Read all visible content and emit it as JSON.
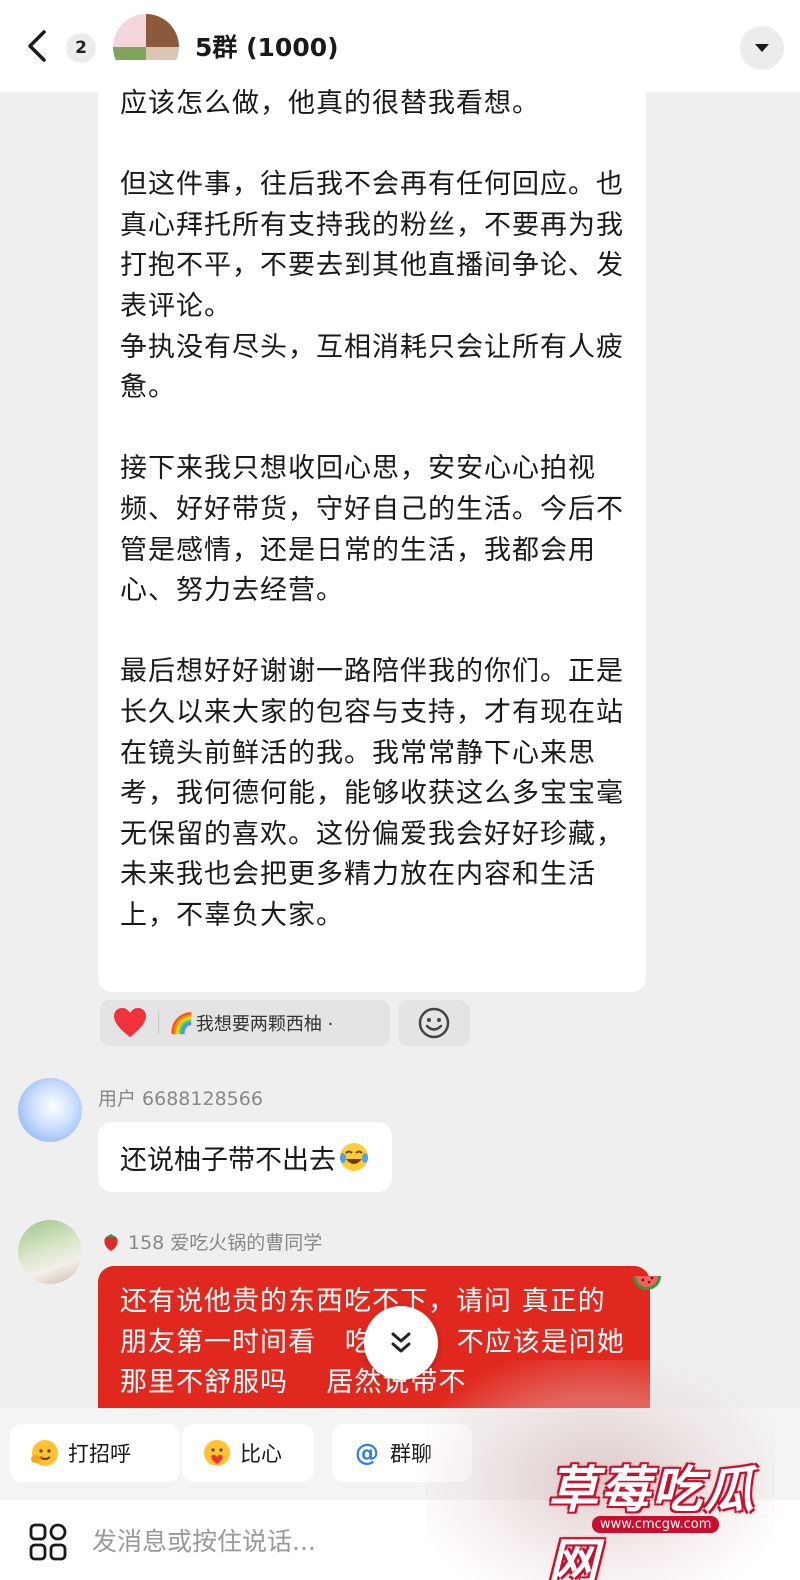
{
  "header": {
    "unread_count": "2",
    "group_title": "5群 (1000)"
  },
  "message_card": {
    "text": "应该怎么做，他真的很替我看想。\n\n但这件事，往后我不会再有任何回应。也真心拜托所有支持我的粉丝，不要再为我打抱不平，不要去到其他直播间争论、发表评论。\n争执没有尽头，互相消耗只会让所有人疲惫。\n\n接下来我只想收回心思，安安心心拍视频、好好带货，守好自己的生活。今后不管是感情，还是日常的生活，我都会用心、努力去经营。\n\n最后想好好谢谢一路陪伴我的你们。正是长久以来大家的包容与支持，才有现在站在镜头前鲜活的我。我常常静下心来思考，我何德何能，能够收获这么多宝宝毫无保留的喜欢。这份偏爱我会好好珍藏，未来我也会把更多精力放在内容和生活上，不辜负大家。",
    "reaction_text": "我想要两颗西柚 ·"
  },
  "messages": [
    {
      "sender": "用户 6688128566",
      "text": "还说柚子带不出去"
    },
    {
      "sender": "158 爱吃火锅的曹同学",
      "text": "还有说他贵的东西吃不下，请问 真正的朋友第一时间看   吃不下，不应该是问她那里不舒服吗    居然说带不"
    }
  ],
  "quick_chips": [
    {
      "label": "打招呼",
      "icon": "wave-emoji-icon"
    },
    {
      "label": "比心",
      "icon": "heart-hands-emoji-icon"
    },
    {
      "label": "群聊",
      "icon": "at-icon"
    }
  ],
  "input": {
    "placeholder": "发消息或按住说话..."
  },
  "watermark": {
    "text": "草莓吃瓜网",
    "url": "www.cmcgw.com"
  },
  "colors": {
    "accent_red": "#e1281e",
    "background": "#efefef",
    "bubble": "#ffffff"
  }
}
